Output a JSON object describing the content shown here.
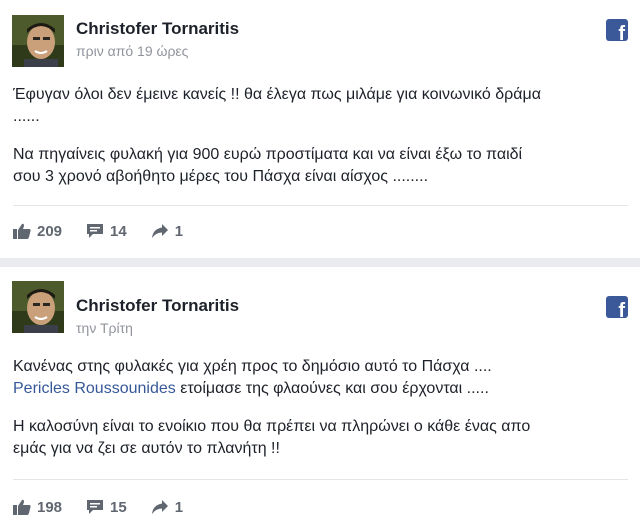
{
  "posts": [
    {
      "author": "Christofer Tornaritis",
      "time": "πριν από 19 ώρες",
      "lines": [
        "Έφυγαν όλοι δεν έμεινε κανείς !! θα έλεγα πως μιλάμε για κοινωνικό δράμα",
        "......"
      ],
      "lines2": [
        "Να πηγαίνεις φυλακή για 900 ευρώ προστίματα και να είναι έξω το παιδί",
        "σου 3 χρονό αβοήθητο μέρες του Πάσχα είναι αίσχος ........"
      ],
      "likes": "209",
      "comments": "14",
      "shares": "1"
    },
    {
      "author": "Christofer Tornaritis",
      "time": "την Τρίτη",
      "line1": "Κανένας στης φυλακές για χρέη προς το δημόσιο αυτό το Πάσχα ....",
      "mention": "Pericles Roussounides",
      "mention_rest": " ετοίμασε της φλαούνες και σου έρχονται .....",
      "lines2": [
        "Η καλοσύνη είναι το ενοίκιο που θα πρέπει να πληρώνει ο κάθε ένας απο",
        "εμάς για να ζει σε αυτόν το πλανήτη !!"
      ],
      "likes": "198",
      "comments": "15",
      "shares": "1"
    }
  ],
  "icons": {
    "facebook": "f"
  },
  "colors": {
    "facebook_blue": "#3b5998",
    "link": "#365899",
    "meta_gray": "#90949c"
  }
}
